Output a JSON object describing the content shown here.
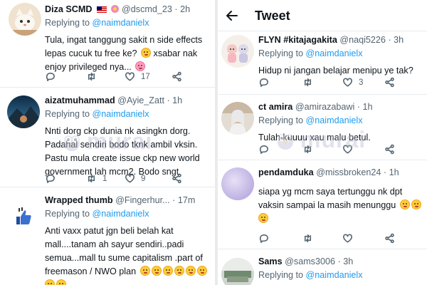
{
  "left_feed": {
    "tweets": [
      {
        "name": "Diza SCMD",
        "handle": "@dscmd_23",
        "time": "2h",
        "reply_prefix": "Replying to",
        "mention": "@naimdanielx",
        "lines": [
          "Tula, ingat tanggung sakit n side effects",
          "lepas cucuk tu free ke?",
          "xsabar nak",
          "enjoy privileged nya..."
        ],
        "counts": {
          "reply": "",
          "retweet": "",
          "like": "17"
        }
      },
      {
        "name": "aizatmuhammad",
        "handle": "@Ayie_Zatt",
        "time": "1h",
        "reply_prefix": "Replying to",
        "mention": "@naimdanielx",
        "lines": [
          "Nnti dorg ckp dunia nk asingkn dorg.",
          "Padahal sendiri bodo tknk ambil vksin.",
          "Pastu mula create issue ckp new world",
          "government lah mcm2. Bodo sngt"
        ],
        "counts": {
          "reply": "",
          "retweet": "1",
          "like": "9"
        }
      },
      {
        "name": "Wrapped thumb",
        "handle": "@Fingerhur...",
        "time": "17m",
        "reply_prefix": "Replying to",
        "mention": "@naimdanielx",
        "lines": [
          "Anti vaxx patut jgn beli belah kat",
          "mall....tanam ah sayur sendiri..padi",
          "semua...mall tu sume capitalism .part of",
          "freemason / NWO plan"
        ],
        "counts": {
          "reply": "",
          "retweet": "",
          "like": ""
        }
      }
    ]
  },
  "right_feed": {
    "header_title": "Tweet",
    "tweets": [
      {
        "name": "FLYN #kitajagakita",
        "handle": "@naqi5226",
        "time": "3h",
        "reply_prefix": "Replying to",
        "mention": "@naimdanielx",
        "lines": [
          "Hidup ni jangan belajar menipu ye tak?"
        ],
        "counts": {
          "reply": "",
          "retweet": "",
          "like": "3"
        }
      },
      {
        "name": "ct amira",
        "handle": "@amirazabawi",
        "time": "1h",
        "reply_prefix": "Replying to",
        "mention": "@naimdanielx",
        "lines": [
          "Tulah kuuuu xau malu betul."
        ],
        "counts": {
          "reply": "",
          "retweet": "",
          "like": ""
        }
      },
      {
        "name": "pendamduka",
        "handle": "@missbroken24",
        "time": "1h",
        "reply_prefix": "",
        "mention": "",
        "lines": [
          "siapa yg mcm saya tertunggu nk dpt",
          "vaksin sampai la masih menunggu"
        ],
        "counts": {
          "reply": "",
          "retweet": "",
          "like": ""
        }
      },
      {
        "name": "Sams",
        "handle": "@sams3006",
        "time": "3h",
        "reply_prefix": "Replying to",
        "mention": "@naimdanielx",
        "lines": [],
        "counts": {
          "reply": "",
          "retweet": "",
          "like": ""
        }
      }
    ]
  },
  "watermark": "murai",
  "icons": {
    "reply": "reply-icon",
    "retweet": "retweet-icon",
    "like": "heart-icon",
    "share": "share-icon",
    "back": "back-arrow-icon"
  },
  "colors": {
    "link": "#1d9bf0",
    "secondary_text": "#536471",
    "divider": "#e6ecf0"
  }
}
